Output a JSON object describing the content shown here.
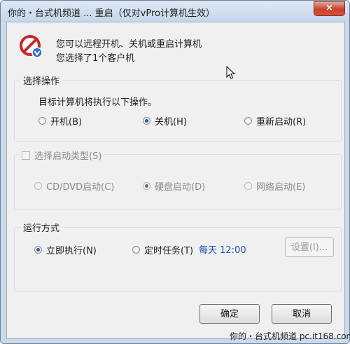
{
  "window": {
    "title": "你的・台式机频道 ... 重启（仅对vPro计算机生效）",
    "close_label": "×"
  },
  "message": {
    "line1": "您可以远程开机、关机或重启计算机",
    "line2": "您选择了1个客户机"
  },
  "operation_group": {
    "label": "选择操作",
    "description": "目标计算机将执行以下操作。",
    "options": [
      {
        "label": "开机(B)",
        "checked": false
      },
      {
        "label": "关机(H)",
        "checked": true
      },
      {
        "label": "重新启动(R)",
        "checked": false
      }
    ]
  },
  "boot_type_group": {
    "checkbox_label": "选择启动类型(S)",
    "checked": false,
    "options": [
      {
        "label": "CD/DVD启动(C)",
        "checked": false
      },
      {
        "label": "硬盘启动(D)",
        "checked": true
      },
      {
        "label": "网络启动(E)",
        "checked": false
      }
    ]
  },
  "run_mode_group": {
    "label": "运行方式",
    "options": [
      {
        "label": "立即执行(N)",
        "checked": true
      },
      {
        "label": "定时任务(T)",
        "checked": false
      }
    ],
    "schedule_time": "每天 12:00",
    "settings_button": "设置(I)..."
  },
  "buttons": {
    "ok": "确定",
    "cancel": "取消"
  },
  "watermark": "你的・台式机频道  pc.it168.com",
  "icons": {
    "app": "no-entry-computer-icon",
    "cursor": "mouse-pointer-icon"
  },
  "colors": {
    "title_bar": "#c4d6ea",
    "close_button": "#c8412c",
    "schedule_time": "#1e50b3",
    "radio_selected": "#2a5a9a"
  }
}
